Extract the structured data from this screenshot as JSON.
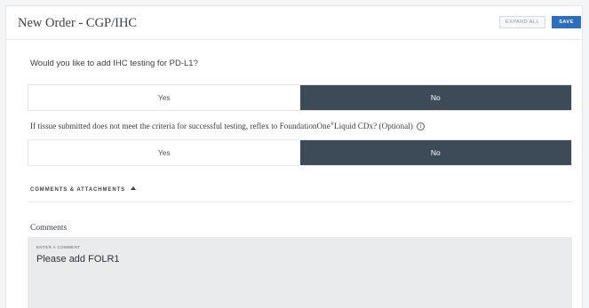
{
  "header": {
    "title": "New Order - CGP/IHC",
    "expand_all_label": "EXPAND ALL",
    "save_label": "SAVE"
  },
  "question_pdl1": {
    "text": "Would you like to add IHC testing for PD-L1?",
    "options": [
      "Yes",
      "No"
    ],
    "selected": "No"
  },
  "question_reflex": {
    "text_before": "If tissue submitted does not meet the criteria for successful testing, reflex to FoundationOne",
    "registered_mark": "®",
    "text_after": "Liquid CDx? (Optional)",
    "info_icon_glyph": "i",
    "options": [
      "Yes",
      "No"
    ],
    "selected": "No"
  },
  "comments_section": {
    "heading": "COMMENTS & ATTACHMENTS",
    "comments_label": "Comments",
    "field_caption": "ENTER A COMMENT",
    "field_value": "Please add FOLR1"
  },
  "colors": {
    "selected_option": "#3d4b59",
    "save_button": "#2d6fba",
    "comment_box": "#e9ebed"
  }
}
